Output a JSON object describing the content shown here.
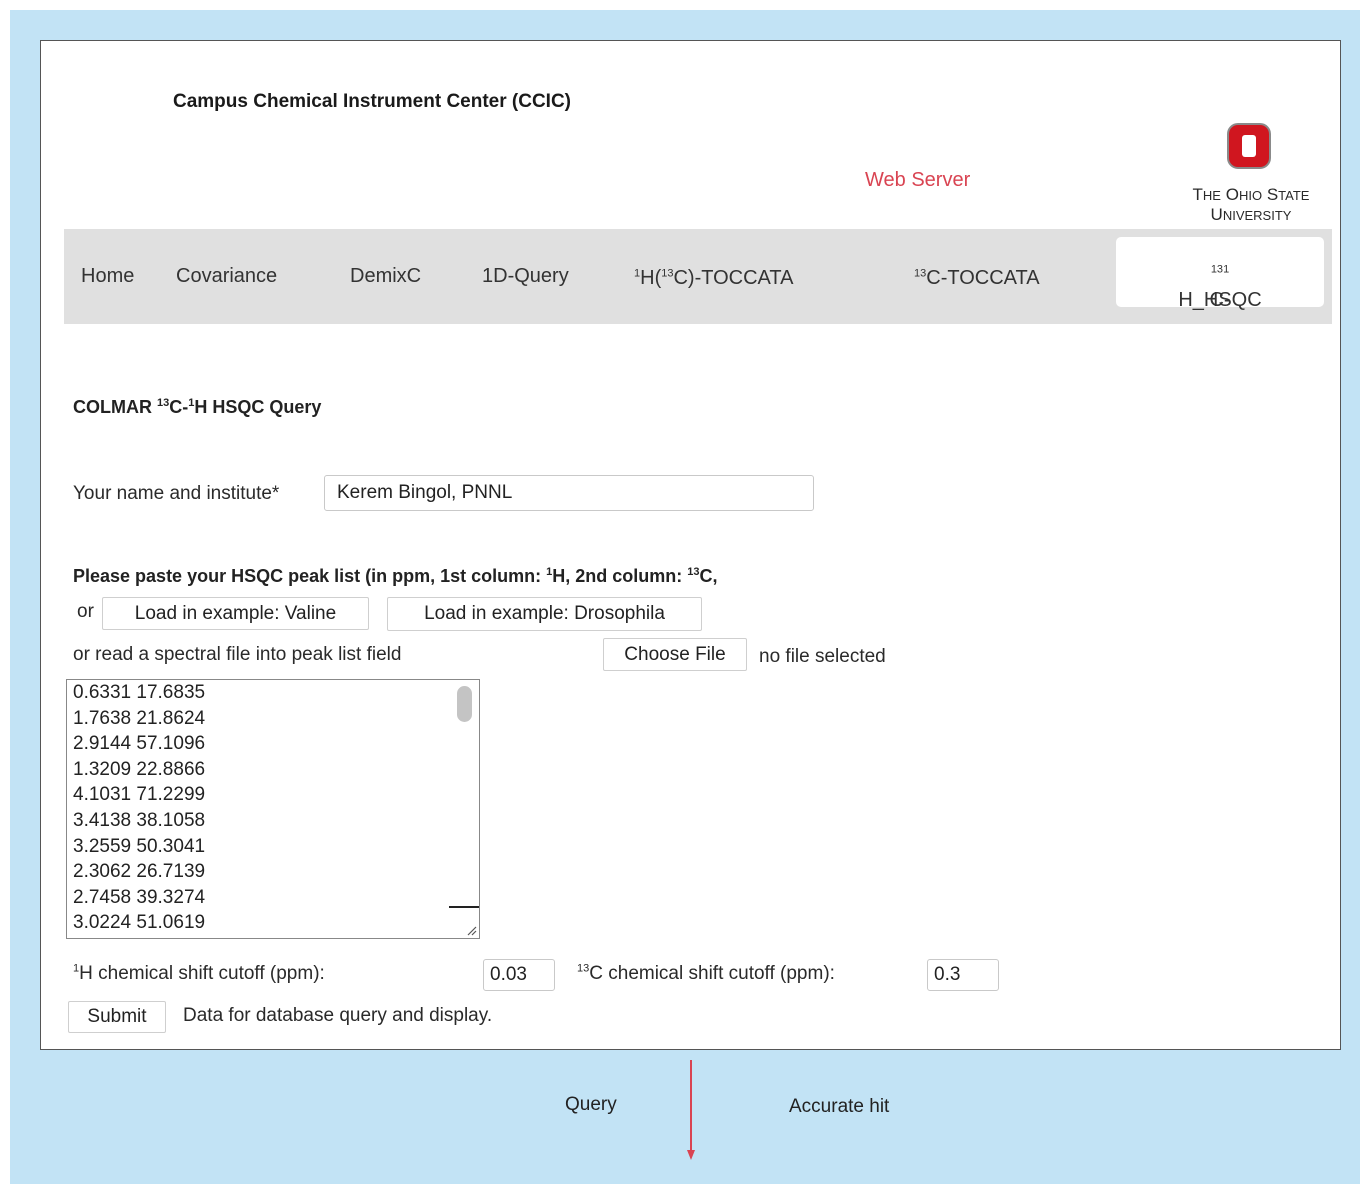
{
  "header": {
    "center_title": "Campus Chemical Instrument Center (CCIC)",
    "web_server": "Web Server",
    "university": {
      "the_T": "T",
      "the_rest": "HE",
      "ohio_O": "O",
      "ohio_rest": "HIO",
      "state_S": "S",
      "state_rest": "TATE",
      "univ_U": "U",
      "univ_rest": "NIVERSITY"
    },
    "logo_color": "#d0161f"
  },
  "nav": {
    "home": "Home",
    "covariance": "Covariance",
    "demixc": "DemixC",
    "query_1d": "1D-Query",
    "h_toccata": {
      "sup1": "1",
      "a": "H(",
      "sup2": "13",
      "b": "C)-TOCCATA"
    },
    "c_toccata": {
      "sup1": "13",
      "a": "C-TOCCATA"
    },
    "hsqc": {
      "sup1": "13",
      "a": "C-",
      "sup2": "1",
      "b": "H_HSQC"
    }
  },
  "form": {
    "title": {
      "a": "COLMAR ",
      "sup1": "13",
      "b": "C-",
      "sup2": "1",
      "c": "H HSQC Query"
    },
    "name_label": "Your name and institute*",
    "name_value": "Kerem Bingol, PNNL",
    "paste_label": {
      "a": "Please paste your HSQC peak list (in ppm,  1st column: ",
      "sup1": "1",
      "b": "H, 2nd column: ",
      "sup2": "13",
      "c": "C,"
    },
    "or": "or",
    "valine_button": "Load in example: Valine",
    "drosophila_button": "Load in example: Drosophila",
    "read_file_label": "or read a spectral file into peak list field",
    "choose_file_button": "Choose File",
    "no_file": "no file selected",
    "peaks": [
      "0.6331 17.6835",
      "1.7638 21.8624",
      "2.9144 57.1096",
      "1.3209 22.8866",
      "4.1031 71.2299",
      "3.4138 38.1058",
      "3.2559 50.3041",
      "2.3062 26.7139",
      "2.7458 39.3274",
      "3.0224 51.0619"
    ],
    "h_cutoff_label": {
      "sup": "1",
      "a": "H chemical shift cutoff (ppm):"
    },
    "h_cutoff_value": "0.03",
    "c_cutoff_label": {
      "sup": "13",
      "a": "C chemical shift cutoff (ppm):"
    },
    "c_cutoff_value": "0.3",
    "submit_button": "Submit",
    "submit_desc": "Data for database query and display."
  },
  "annotations": {
    "query": "Query",
    "accurate_hit": "Accurate hit",
    "arrow_color": "#d94452"
  }
}
